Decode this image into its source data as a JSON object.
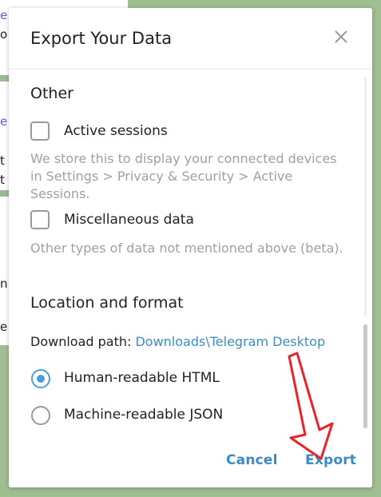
{
  "background": {
    "fragments": [
      "e",
      "o",
      "e",
      "t",
      "t",
      "n",
      "e"
    ]
  },
  "dialog": {
    "title": "Export Your Data",
    "close_icon": "close-icon",
    "other_section": {
      "title": "Other",
      "active_sessions": {
        "label": "Active sessions",
        "checked": false,
        "description": "We store this to display your connected devices in Settings > Privacy & Security > Active Sessions."
      },
      "misc_data": {
        "label": "Miscellaneous data",
        "checked": false,
        "description": "Other types of data not mentioned above (beta)."
      }
    },
    "location_section": {
      "title": "Location and format",
      "download_path_label": "Download path:",
      "download_path_value": "Downloads\\Telegram Desktop",
      "formats": [
        {
          "label": "Human-readable HTML",
          "selected": true
        },
        {
          "label": "Machine-readable JSON",
          "selected": false
        }
      ]
    },
    "buttons": {
      "cancel": "Cancel",
      "export": "Export"
    }
  },
  "colors": {
    "accent": "#3a8cc6",
    "radio": "#4a9fd8",
    "annotation_arrow": "#e8232a",
    "background_green": "#9fbf92"
  }
}
